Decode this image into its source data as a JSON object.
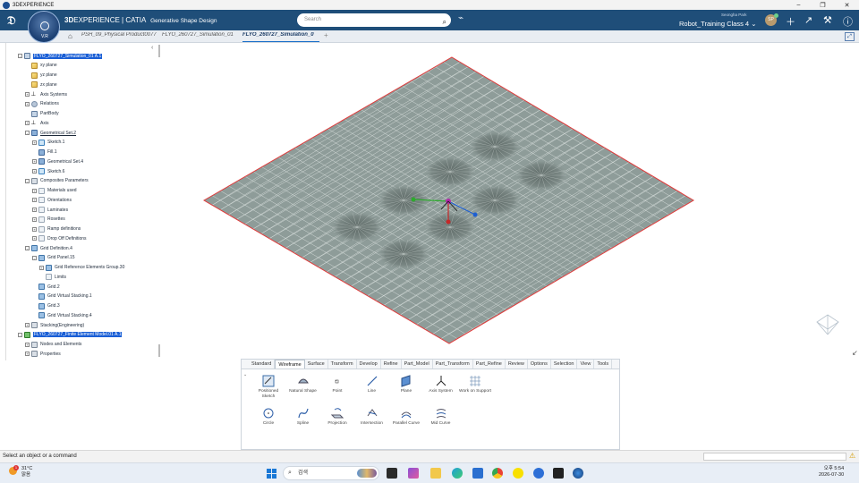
{
  "window": {
    "title": "3DEXPERIENCE",
    "min": "–",
    "max": "❐",
    "close": "✕"
  },
  "topbar": {
    "brand_bold": "3D",
    "brand_rest": "EXPERIENCE | CATIA",
    "app_name": "Generative Shape Design",
    "compass_version": "V.R",
    "search_placeholder": "Search",
    "user_name": "Seongha Park",
    "collab_space": "Robot_Training Class 4",
    "avatar_initials": "SP"
  },
  "tabs": [
    {
      "label": "PSH_09_Physical Product0077",
      "active": false
    },
    {
      "label": "FLYO_260727_Simulation_01",
      "active": false
    },
    {
      "label": "FLYO_260727_Simulation_0",
      "active": true
    }
  ],
  "tree": [
    {
      "label": "FLYO_260727_Simulation_01 A.1",
      "indent": 0,
      "icon": "part",
      "pm": "-",
      "selected": true
    },
    {
      "label": "xy plane",
      "indent": 1,
      "icon": "plane",
      "pm": ""
    },
    {
      "label": "yz plane",
      "indent": 1,
      "icon": "plane",
      "pm": ""
    },
    {
      "label": "zx plane",
      "indent": 1,
      "icon": "plane",
      "pm": ""
    },
    {
      "label": "Axis Systems",
      "indent": 1,
      "icon": "axis",
      "pm": "+"
    },
    {
      "label": "Relations",
      "indent": 1,
      "icon": "rel",
      "pm": "+"
    },
    {
      "label": "PartBody",
      "indent": 1,
      "icon": "part",
      "pm": ""
    },
    {
      "label": "Axis",
      "indent": 1,
      "icon": "axis",
      "pm": "+"
    },
    {
      "label": "Geometrical Set.2",
      "indent": 1,
      "icon": "geo",
      "pm": "-",
      "underline": true
    },
    {
      "label": "Sketch.1",
      "indent": 2,
      "icon": "sketch",
      "pm": "+"
    },
    {
      "label": "Fill.1",
      "indent": 2,
      "icon": "geo",
      "pm": ""
    },
    {
      "label": "Geometrical Set.4",
      "indent": 2,
      "icon": "geo",
      "pm": "+"
    },
    {
      "label": "Sketch.6",
      "indent": 2,
      "icon": "sketch",
      "pm": "+"
    },
    {
      "label": "Composites Parameters",
      "indent": 1,
      "icon": "folder",
      "pm": "-"
    },
    {
      "label": "Materials used",
      "indent": 2,
      "icon": "",
      "pm": "+"
    },
    {
      "label": "Orientations",
      "indent": 2,
      "icon": "",
      "pm": "+"
    },
    {
      "label": "Laminates",
      "indent": 2,
      "icon": "",
      "pm": "+"
    },
    {
      "label": "Rosettes",
      "indent": 2,
      "icon": "",
      "pm": "+"
    },
    {
      "label": "Ramp definitions",
      "indent": 2,
      "icon": "",
      "pm": "+"
    },
    {
      "label": "Drop Off Definitions",
      "indent": 2,
      "icon": "",
      "pm": "+"
    },
    {
      "label": "Grid Definition.4",
      "indent": 1,
      "icon": "grid",
      "pm": "-"
    },
    {
      "label": "Grid Panel.15",
      "indent": 2,
      "icon": "grid",
      "pm": "-"
    },
    {
      "label": "Grid Reference Elements Group.30",
      "indent": 3,
      "icon": "grid",
      "pm": "+"
    },
    {
      "label": "Limits",
      "indent": 3,
      "icon": "",
      "pm": ""
    },
    {
      "label": "Grid.2",
      "indent": 2,
      "icon": "grid",
      "pm": ""
    },
    {
      "label": "Grid Virtual Stacking.1",
      "indent": 2,
      "icon": "grid",
      "pm": ""
    },
    {
      "label": "Grid.3",
      "indent": 2,
      "icon": "grid",
      "pm": ""
    },
    {
      "label": "Grid Virtual Stacking.4",
      "indent": 2,
      "icon": "grid",
      "pm": ""
    },
    {
      "label": "Stacking(Engineering)",
      "indent": 1,
      "icon": "folder",
      "pm": "+"
    },
    {
      "label": "FLYO_260727_Finite Element Model.01 A.1",
      "indent": 0,
      "icon": "fem",
      "pm": "-",
      "selected": true
    },
    {
      "label": "Nodes and Elements",
      "indent": 1,
      "icon": "folder",
      "pm": "+"
    },
    {
      "label": "Properties",
      "indent": 1,
      "icon": "folder",
      "pm": "+"
    }
  ],
  "actionbar": {
    "tabs": [
      "Standard",
      "Wireframe",
      "Surface",
      "Transform",
      "Develop",
      "Refine",
      "Part_Model",
      "Part_Transform",
      "Part_Refine",
      "Review",
      "Options",
      "Selection",
      "View",
      "Tools"
    ],
    "active_tab": "Wireframe",
    "row1": [
      {
        "label": "Positioned Sketch",
        "icon": "positioned-sketch-icon"
      },
      {
        "label": "Natural Shape",
        "icon": "natural-shape-icon"
      },
      {
        "label": "Point",
        "icon": "point-icon"
      },
      {
        "label": "Line",
        "icon": "line-icon"
      },
      {
        "label": "Plane",
        "icon": "plane-icon"
      },
      {
        "label": "Axis System",
        "icon": "axis-system-icon"
      },
      {
        "label": "Work on Support",
        "icon": "work-on-support-icon"
      }
    ],
    "row2": [
      {
        "label": "Circle",
        "icon": "circle-icon"
      },
      {
        "label": "Spline",
        "icon": "spline-icon"
      },
      {
        "label": "Projection",
        "icon": "projection-icon"
      },
      {
        "label": "Intersection",
        "icon": "intersection-icon"
      },
      {
        "label": "Parallel Curve",
        "icon": "parallel-curve-icon"
      },
      {
        "label": "Mid Curve",
        "icon": "mid-curve-icon"
      }
    ]
  },
  "status": {
    "message": "Select an object or a command"
  },
  "taskbar": {
    "temp": "31°C",
    "weather": "맑음",
    "badge": "1",
    "search": "검색",
    "time": "오후 5:54",
    "date": "2026-07-30"
  },
  "colors": {
    "accent": "#1f4e79",
    "selection": "#1a5fd6",
    "mesh": "#8e9c99",
    "mesh_edge": "#e03b3b"
  }
}
